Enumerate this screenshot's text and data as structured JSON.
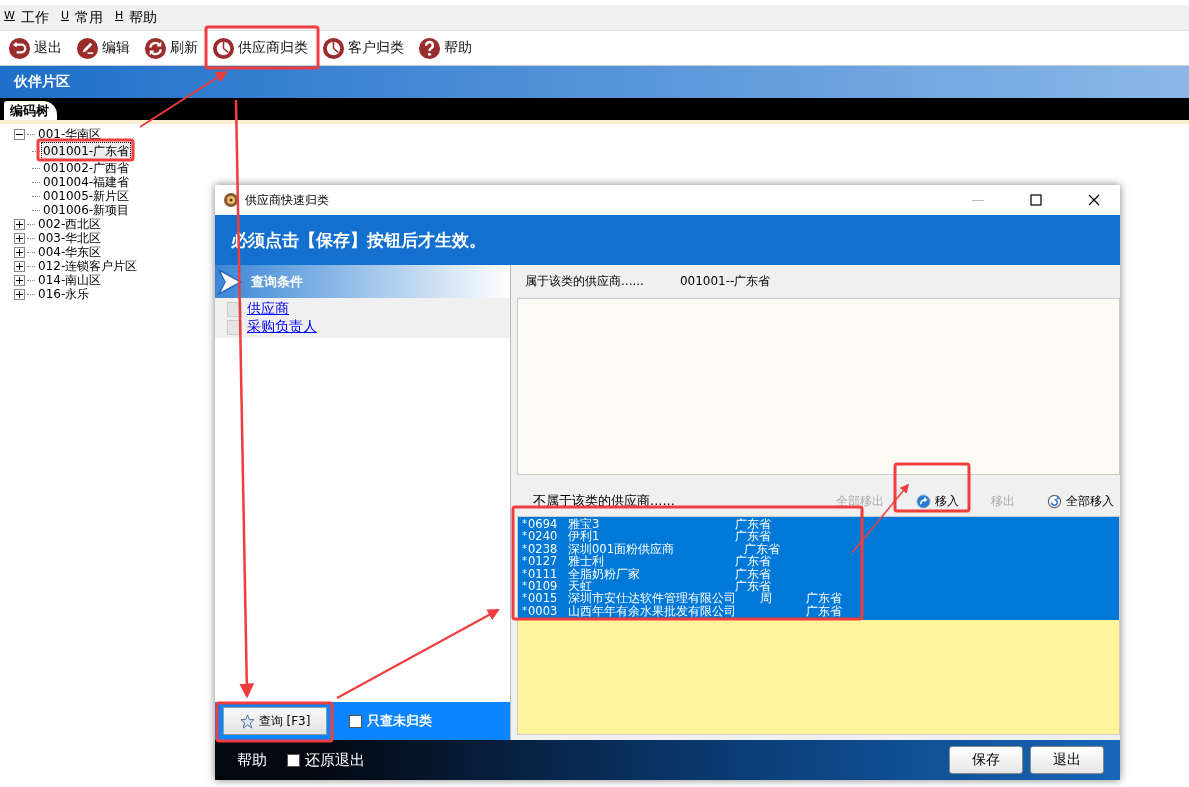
{
  "menu": [
    {
      "key": "W",
      "label": "工作"
    },
    {
      "key": "U",
      "label": "常用"
    },
    {
      "key": "H",
      "label": "帮助"
    }
  ],
  "toolbar": [
    {
      "kind": "exit",
      "label": "退出"
    },
    {
      "kind": "edit",
      "label": "编辑"
    },
    {
      "kind": "refresh",
      "label": "刷新"
    },
    {
      "kind": "pie",
      "label": "供应商归类"
    },
    {
      "kind": "pie",
      "label": "客户归类"
    },
    {
      "kind": "help",
      "label": "帮助"
    }
  ],
  "header": {
    "title": "伙伴片区"
  },
  "tabs": [
    {
      "label": "编码树",
      "selected": true
    }
  ],
  "tree": [
    {
      "label": "001-华南区",
      "expanded": true,
      "selected": false,
      "children": [
        {
          "label": "001001-广东省",
          "selected": true
        },
        {
          "label": "001002-广西省",
          "selected": false
        },
        {
          "label": "001004-福建省",
          "selected": false
        },
        {
          "label": "001005-新片区",
          "selected": false
        },
        {
          "label": "001006-新项目",
          "selected": false
        }
      ]
    },
    {
      "label": "002-西北区",
      "expanded": false,
      "selected": false
    },
    {
      "label": "003-华北区",
      "expanded": false,
      "selected": false
    },
    {
      "label": "004-华东区",
      "expanded": false,
      "selected": false
    },
    {
      "label": "012-连锁客户片区",
      "expanded": false,
      "selected": false
    },
    {
      "label": "014-南山区",
      "expanded": false,
      "selected": false
    },
    {
      "label": "016-永乐",
      "expanded": false,
      "selected": false
    }
  ],
  "dialog": {
    "title": "供应商快速归类",
    "notice": "必须点击【保存】按钮后才生效。",
    "query_header": "查询条件",
    "conditions": [
      {
        "label": "供应商",
        "checked": false
      },
      {
        "label": "采购负责人",
        "checked": false
      }
    ],
    "query_button": "查询 [F3]",
    "only_unclassified": {
      "label": "只查未归类",
      "checked": false
    },
    "assigned_header": {
      "label": "属于该类的供应商......",
      "category": "001001--广东省"
    },
    "unassigned_label": "不属于该类的供应商......",
    "actions": [
      {
        "kind": "plain",
        "label": "全部移出",
        "disabled": true
      },
      {
        "kind": "move_in",
        "label": "移入",
        "disabled": false
      },
      {
        "kind": "plain",
        "label": "移出",
        "disabled": true
      },
      {
        "kind": "move_all_in",
        "label": "全部移入",
        "disabled": false
      }
    ],
    "suppliers": [
      {
        "mark": "*",
        "code": "0694",
        "name": "雅宝3",
        "region": "广东省"
      },
      {
        "mark": "*",
        "code": "0240",
        "name": "伊利1",
        "region": "广东省"
      },
      {
        "mark": "*",
        "code": "0238",
        "name": "深圳001面粉供应商",
        "region": "广东省"
      },
      {
        "mark": "*",
        "code": "0127",
        "name": "雅士利",
        "region": "广东省"
      },
      {
        "mark": "*",
        "code": "0111",
        "name": "全脂奶粉厂家",
        "region": "广东省"
      },
      {
        "mark": "*",
        "code": "0109",
        "name": "天虹",
        "region": "广东省"
      },
      {
        "mark": "*",
        "code": "0015",
        "name": "深圳市安仕达软件管理有限公司",
        "contact": "周",
        "region": "广东省"
      },
      {
        "mark": "*",
        "code": "0003",
        "name": "山西年年有余水果批发有限公司",
        "region": "广东省"
      }
    ],
    "footer_help": "帮助",
    "restore_exit": {
      "label": "还原退出",
      "checked": false
    },
    "buttons": [
      "保存",
      "退出"
    ]
  }
}
